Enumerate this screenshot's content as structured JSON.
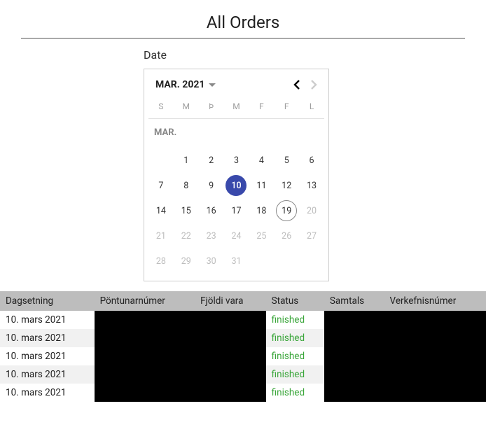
{
  "title": "All Orders",
  "date_label": "Date",
  "calendar": {
    "month_label": "MAR. 2021",
    "month_abbr": "MAR.",
    "dow": [
      "S",
      "M",
      "Þ",
      "M",
      "F",
      "F",
      "L"
    ],
    "selected_day": 10,
    "today": 19,
    "first_day_offset": 1,
    "days_in_month": 31,
    "disabled_from": 20,
    "prev_enabled": true,
    "next_enabled": false
  },
  "columns": [
    "Dagsetning",
    "Pöntunarnúmer",
    "Fjöldi vara",
    "Status",
    "Samtals",
    "Verkefnisnúmer"
  ],
  "status_label": "finished",
  "rows": [
    {
      "date": "10. mars 2021",
      "status": "finished"
    },
    {
      "date": "10. mars 2021",
      "status": "finished"
    },
    {
      "date": "10. mars 2021",
      "status": "finished"
    },
    {
      "date": "10. mars 2021",
      "status": "finished"
    },
    {
      "date": "10. mars 2021",
      "status": "finished"
    }
  ]
}
